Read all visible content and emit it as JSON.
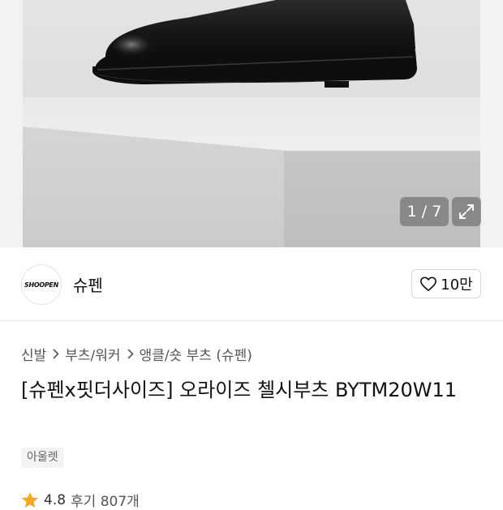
{
  "gallery": {
    "counter": "1 / 7",
    "expand_icon": "expand-icon"
  },
  "brand": {
    "logo_text": "SHOOPEN",
    "name": "슈펜",
    "like_icon": "heart-outline-icon",
    "like_count": "10만"
  },
  "breadcrumb": {
    "items": [
      "신발",
      "부츠/워커",
      "앵클/숏 부츠 (슈펜)"
    ],
    "separator_icon": "chevron-right-icon"
  },
  "product": {
    "title": "[슈펜x핏더사이즈] 오라이즈 첼시부츠 BYTM20W11",
    "badge": "아울렛",
    "rating_icon": "star-icon",
    "rating_score": "4.8",
    "review_label": "후기 807개"
  },
  "colors": {
    "star": "#f5a623",
    "overlay": "rgba(90,90,90,0.55)"
  }
}
